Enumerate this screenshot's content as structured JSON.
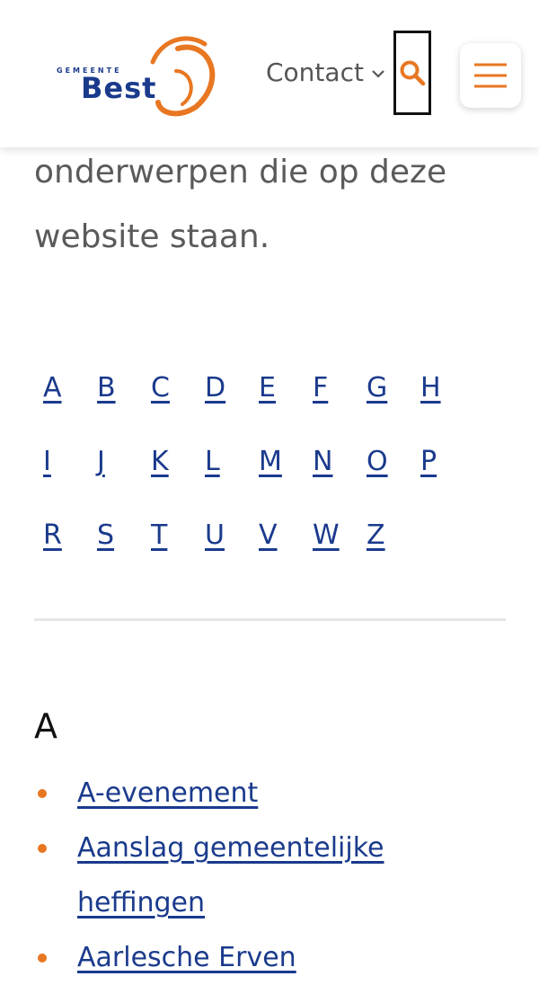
{
  "header": {
    "logo": {
      "small_text": "GEMEENTE",
      "big_text": "Best",
      "icon": "best-logo-swirl"
    },
    "contact_label": "Contact",
    "search_icon": "search-icon",
    "menu_icon": "hamburger-icon"
  },
  "intro": {
    "line1": "onderwerpen die op deze",
    "line2": "website staan."
  },
  "alphabet": {
    "rows": [
      [
        "A",
        "B",
        "C",
        "D",
        "E",
        "F",
        "G",
        "H"
      ],
      [
        "I",
        "J",
        "K",
        "L",
        "M",
        "N",
        "O",
        "P"
      ],
      [
        "R",
        "S",
        "T",
        "U",
        "V",
        "W",
        "Z"
      ]
    ]
  },
  "section": {
    "letter": "A",
    "items": [
      "A-evenement",
      "Aanslag gemeentelijke heffingen",
      "Aarlesche Erven"
    ]
  },
  "colors": {
    "accent": "#E87722",
    "link": "#1A3A8C",
    "text": "#555555"
  }
}
